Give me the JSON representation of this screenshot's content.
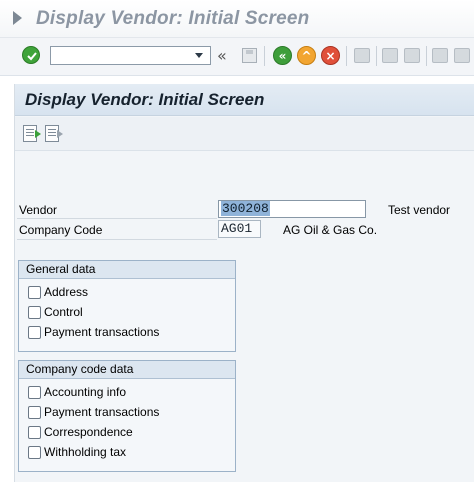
{
  "window": {
    "title": "Display Vendor:  Initial Screen"
  },
  "toolbar": {
    "command_field_value": "",
    "icons": [
      "enter-icon",
      "command-dropdown-icon",
      "double-left-icon",
      "save-icon",
      "back-icon",
      "exit-icon",
      "cancel-icon",
      "print-icon",
      "find-icon",
      "find-next-icon",
      "first-page-icon",
      "previous-page-icon"
    ]
  },
  "screen": {
    "title": "Display Vendor:  Initial Screen",
    "app_icons": [
      "display-document-icon",
      "other-document-icon"
    ]
  },
  "form": {
    "vendor_label": "Vendor",
    "vendor_value": "300208",
    "vendor_description": "Test vendor",
    "company_code_label": "Company Code",
    "company_code_value": "AG01",
    "company_code_description": "AG Oil & Gas Co."
  },
  "general_data": {
    "title": "General data",
    "items": [
      {
        "label": "Address",
        "checked": false
      },
      {
        "label": "Control",
        "checked": false
      },
      {
        "label": "Payment transactions",
        "checked": false
      }
    ]
  },
  "company_code_data": {
    "title": "Company code data",
    "items": [
      {
        "label": "Accounting info",
        "checked": false
      },
      {
        "label": "Payment transactions",
        "checked": false
      },
      {
        "label": "Correspondence",
        "checked": false
      },
      {
        "label": "Withholding tax",
        "checked": false
      }
    ]
  },
  "colors": {
    "header_band": "#d7e3ef",
    "selection": "#8fb3d9",
    "enter_green": "#3e9e3a",
    "exit_orange": "#f2a531",
    "cancel_red": "#e0503a"
  }
}
